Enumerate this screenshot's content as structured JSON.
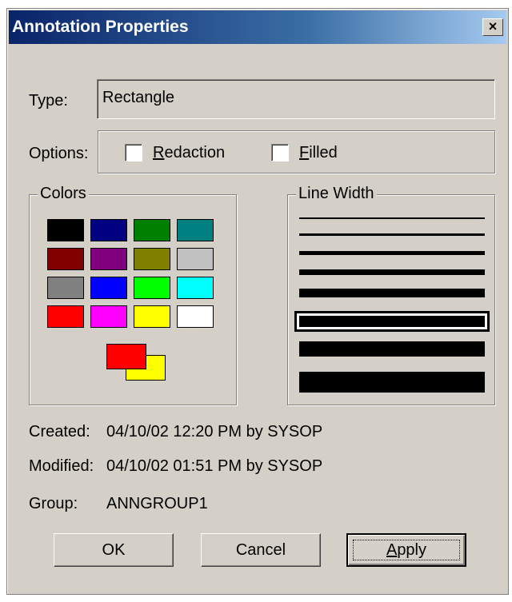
{
  "window": {
    "title": "Annotation Properties",
    "close_glyph": "×"
  },
  "type_field": {
    "label": "Type:",
    "value": "Rectangle"
  },
  "options": {
    "label": "Options:",
    "redaction": {
      "underline": "R",
      "rest": "edaction",
      "checked": false
    },
    "filled": {
      "underline": "F",
      "rest": "illed",
      "checked": false
    }
  },
  "colors": {
    "legend": "Colors",
    "palette": [
      [
        "#000000",
        "#000080",
        "#008000",
        "#008080"
      ],
      [
        "#800000",
        "#800080",
        "#808000",
        "#c0c0c0"
      ],
      [
        "#808080",
        "#0000ff",
        "#00ff00",
        "#00ffff"
      ],
      [
        "#ff0000",
        "#ff00ff",
        "#ffff00",
        "#ffffff"
      ]
    ],
    "foreground": "#ff0000",
    "background": "#ffff00"
  },
  "line_width": {
    "legend": "Line Width",
    "selected_index": 5
  },
  "info": {
    "created_label": "Created:",
    "created_value": "04/10/02 12:20 PM by SYSOP",
    "modified_label": "Modified:",
    "modified_value": "04/10/02 01:51 PM by SYSOP",
    "group_label": "Group:",
    "group_value": "ANNGROUP1"
  },
  "buttons": {
    "ok": "OK",
    "cancel": "Cancel",
    "apply_underline": "A",
    "apply_rest": "pply"
  }
}
